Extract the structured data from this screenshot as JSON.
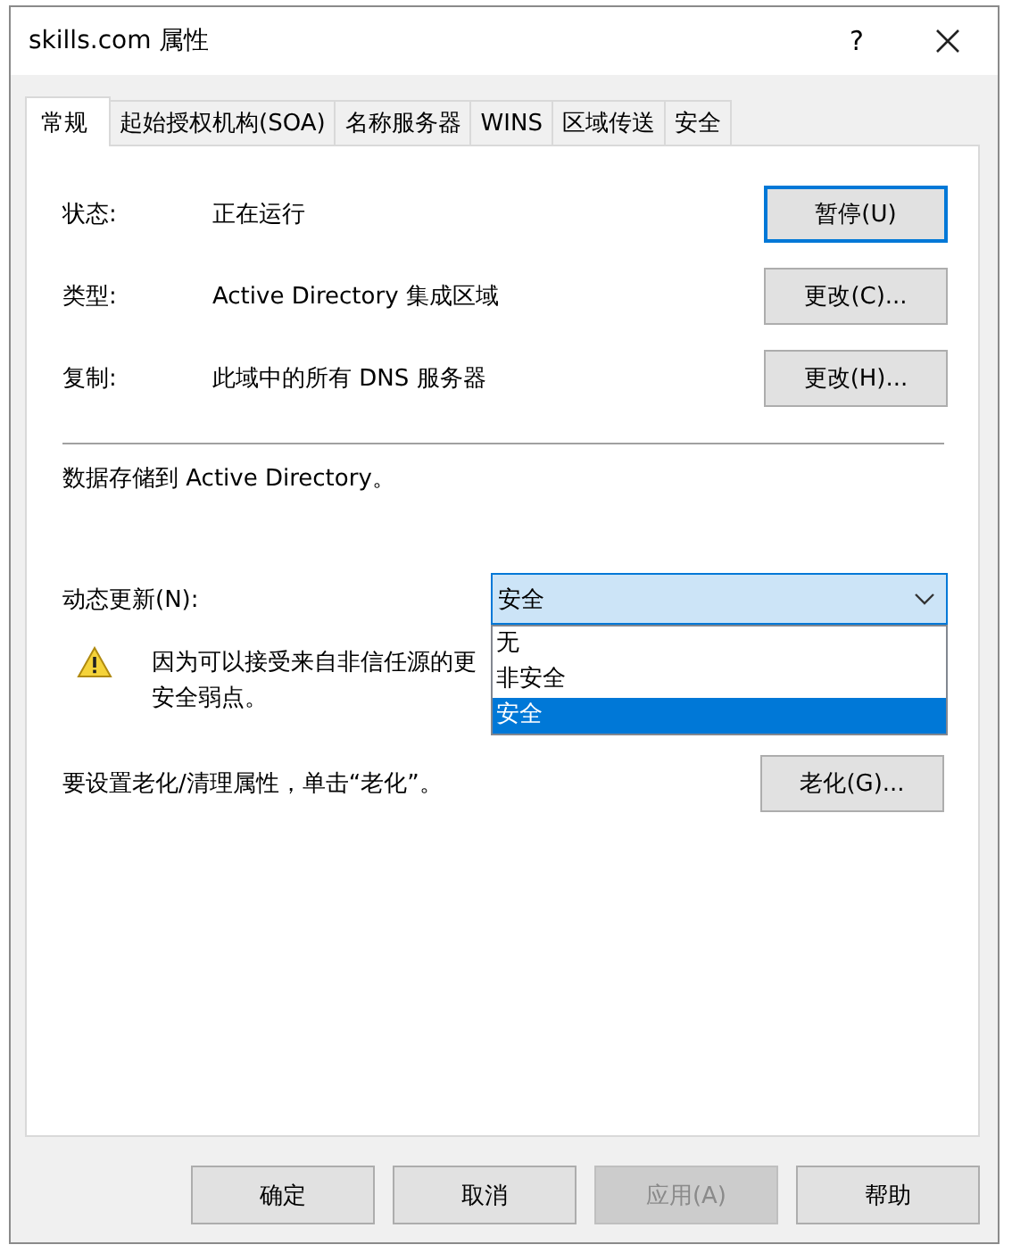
{
  "window": {
    "title": "skills.com 属性",
    "help_button": "?"
  },
  "tabs": [
    {
      "label": "常规",
      "selected": true
    },
    {
      "label": "起始授权机构(SOA)",
      "selected": false
    },
    {
      "label": "名称服务器",
      "selected": false
    },
    {
      "label": "WINS",
      "selected": false
    },
    {
      "label": "区域传送",
      "selected": false
    },
    {
      "label": "安全",
      "selected": false
    }
  ],
  "properties": [
    {
      "label": "状态:",
      "value": "正在运行",
      "button": "暂停(U)",
      "focused": true
    },
    {
      "label": "类型:",
      "value": "Active Directory 集成区域",
      "button": "更改(C)...",
      "focused": false
    },
    {
      "label": "复制:",
      "value": "此域中的所有 DNS 服务器",
      "button": "更改(H)...",
      "focused": false
    }
  ],
  "storage_note": "数据存储到 Active Directory。",
  "dynamic_update": {
    "label": "动态更新(N):",
    "value": "安全",
    "expanded": true,
    "options": [
      {
        "label": "无",
        "selected": false
      },
      {
        "label": "非安全",
        "selected": false
      },
      {
        "label": "安全",
        "selected": true
      }
    ]
  },
  "warning": {
    "lines": [
      "因为可以接受来自非信任源的更",
      "安全弱点。"
    ]
  },
  "aging": {
    "text": "要设置老化/清理属性，单击“老化”。",
    "button": "老化(G)..."
  },
  "buttons": [
    {
      "label": "确定",
      "disabled": false
    },
    {
      "label": "取消",
      "disabled": false
    },
    {
      "label": "应用(A)",
      "disabled": true
    },
    {
      "label": "帮助",
      "disabled": false
    }
  ]
}
